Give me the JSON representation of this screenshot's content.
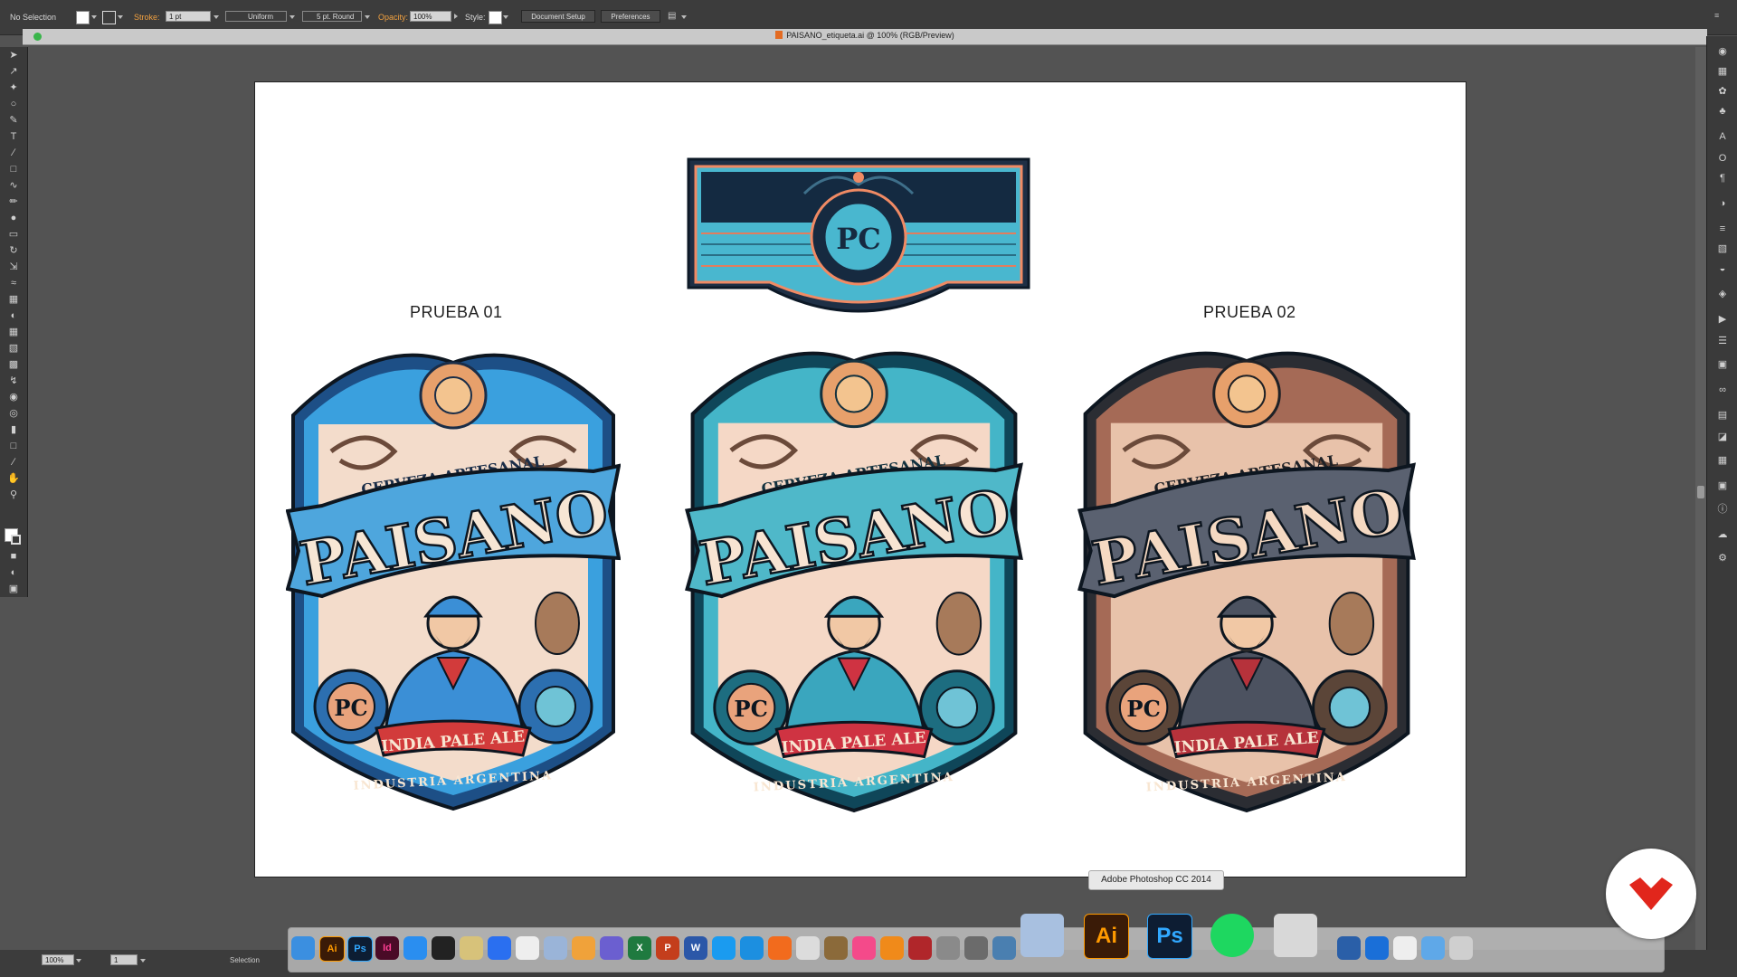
{
  "control_bar": {
    "selection_label": "No Selection",
    "stroke_label": "Stroke:",
    "stroke_weight": "1 pt",
    "stroke_profile": "Uniform",
    "brush": "5 pt. Round",
    "opacity_label": "Opacity:",
    "opacity_value": "100%",
    "style_label": "Style:",
    "document_setup": "Document Setup",
    "preferences": "Preferences"
  },
  "document": {
    "title": "PAISANO_etiqueta.ai @ 100% (RGB/Preview)"
  },
  "artboard": {
    "caption_left": "PRUEBA 01",
    "caption_right": "PRUEBA 02",
    "labels": [
      {
        "subtitle": "CERVEZA ARTESANAL",
        "brand": "PAISANO",
        "style": "INDIA PALE ALE",
        "footer": "INDUSTRIA ARGENTINA",
        "palette": "blue",
        "band_color": "#4ea6dd"
      },
      {
        "subtitle": "CERVEZA ARTESANAL",
        "brand": "PAISANO",
        "style": "INDIA PALE ALE",
        "footer": "INDUSTRIA ARGENTINA",
        "palette": "teal",
        "band_color": "#4fb8c9"
      },
      {
        "subtitle": "CERVEZA ARTESANAL",
        "brand": "PAISANO",
        "style": "INDIA PALE ALE",
        "footer": "INDUSTRIA ARGENTINA",
        "palette": "gray",
        "band_color": "#5a6170"
      }
    ],
    "neck_label": {
      "monogram": "PC"
    }
  },
  "status_bar": {
    "zoom": "100%",
    "page": "1",
    "tool": "Selection"
  },
  "dock": {
    "tooltip": "Adobe Photoshop CC 2014",
    "apps": [
      "finder",
      "illustrator",
      "photoshop",
      "indesign",
      "app-store",
      "davinci",
      "notes",
      "dropbox",
      "text-edit",
      "preview",
      "photos",
      "imovie",
      "excel",
      "powerpoint",
      "word",
      "safari",
      "skype",
      "firefox",
      "launchpad",
      "books-gear",
      "itunes",
      "ibooks",
      "photo-booth",
      "system-prefs",
      "disk-utility",
      "image-capture",
      "preview-2",
      "illustrator-large",
      "photoshop-large",
      "spotify",
      "fontexplorer",
      "virtualbox",
      "quicktime",
      "usb",
      "folder",
      "trash"
    ]
  }
}
